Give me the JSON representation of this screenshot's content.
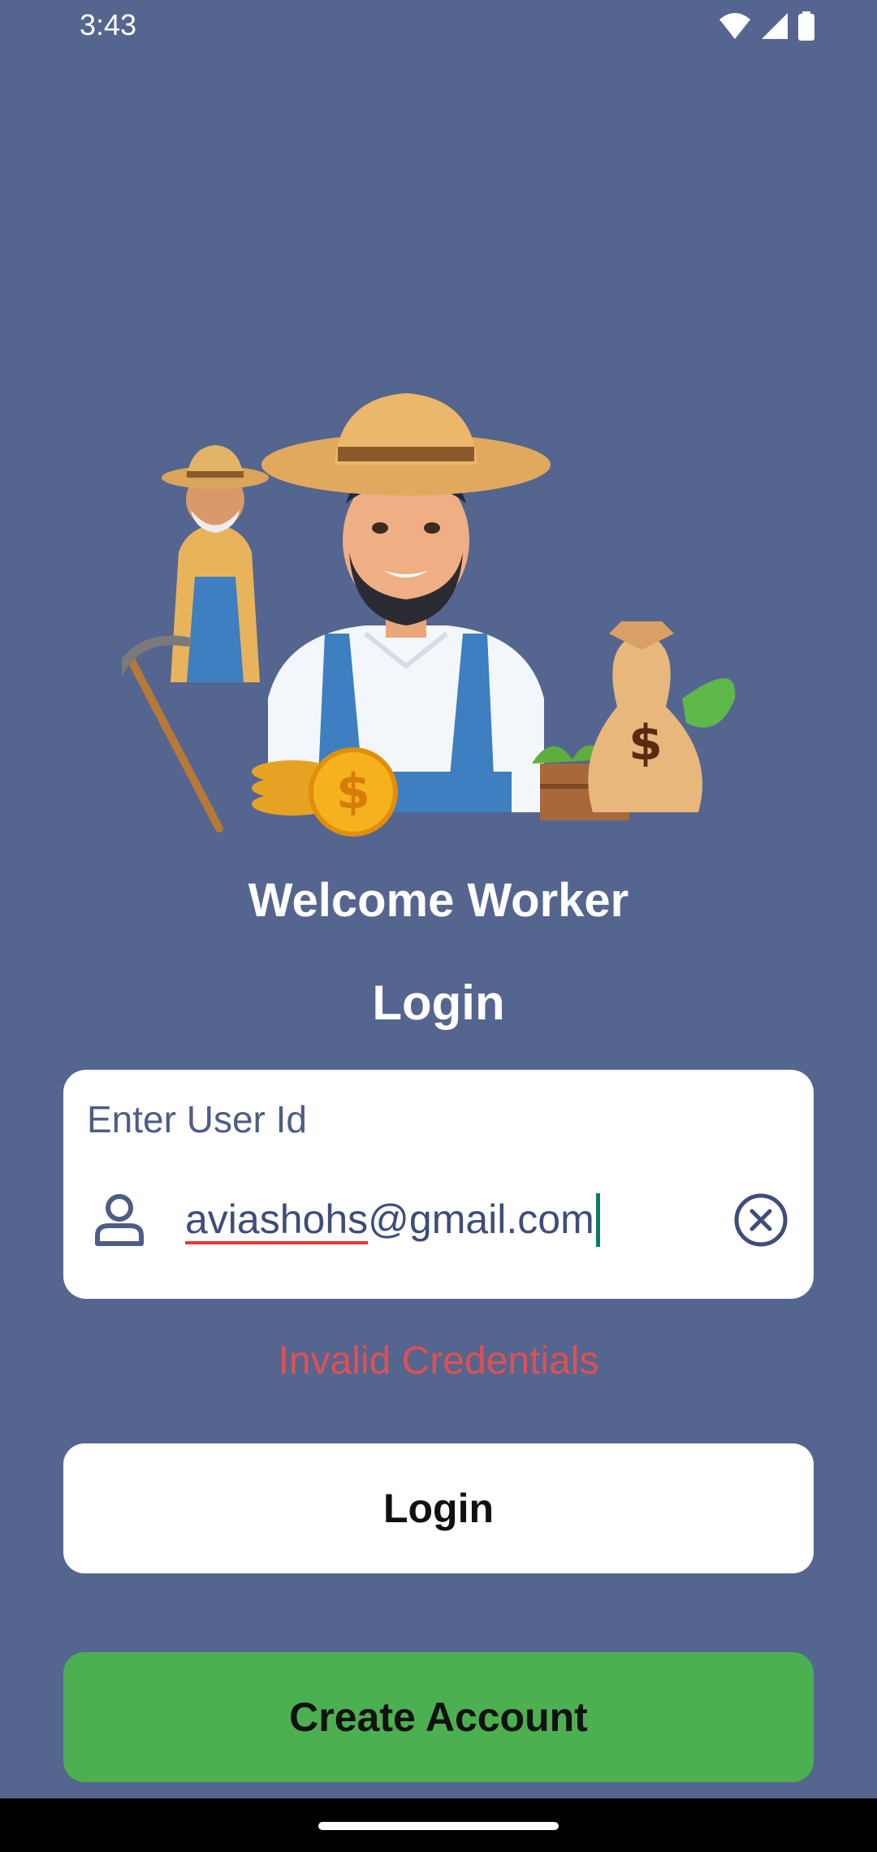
{
  "status_bar": {
    "time": "3:43",
    "icons": [
      "wifi-icon",
      "signal-icon",
      "battery-icon"
    ]
  },
  "hero": {
    "image": "farmer-workers-illustration"
  },
  "header": {
    "welcome": "Welcome Worker",
    "title": "Login"
  },
  "form": {
    "user_id_label": "Enter User Id",
    "user_id_value_underlined": "aviashohs",
    "user_id_value_rest": "@gmail.com",
    "error": "Invalid Credentials"
  },
  "buttons": {
    "login": "Login",
    "create_account": "Create Account"
  },
  "colors": {
    "background": "#54658F",
    "card": "#FFFFFF",
    "error": "#E05050",
    "create_button": "#4CAF50",
    "caret": "#0F7A6A"
  }
}
